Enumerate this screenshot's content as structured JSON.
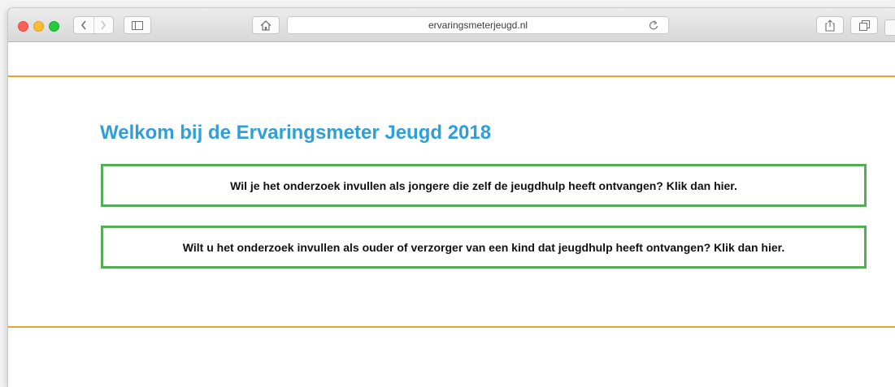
{
  "browser": {
    "url": "ervaringsmeterjeugd.nl",
    "icons": {
      "back": "chevron-left-icon",
      "forward": "chevron-right-icon",
      "sidebar": "sidebar-icon",
      "home": "home-icon",
      "reload": "reload-icon",
      "share": "share-icon",
      "tabs": "tabs-icon"
    }
  },
  "page": {
    "title": "Welkom bij de Ervaringsmeter Jeugd 2018",
    "options": [
      {
        "label": "Wil je het onderzoek invullen als jongere die zelf de jeugdhulp heeft ontvangen? Klik dan hier."
      },
      {
        "label": "Wilt u het onderzoek invullen als ouder of verzorger van een kind dat jeugdhulp heeft ontvangen? Klik dan hier."
      }
    ]
  },
  "colors": {
    "heading": "#2f9fd8",
    "accent_rule": "#f0a030",
    "button_border": "#56ad58"
  }
}
